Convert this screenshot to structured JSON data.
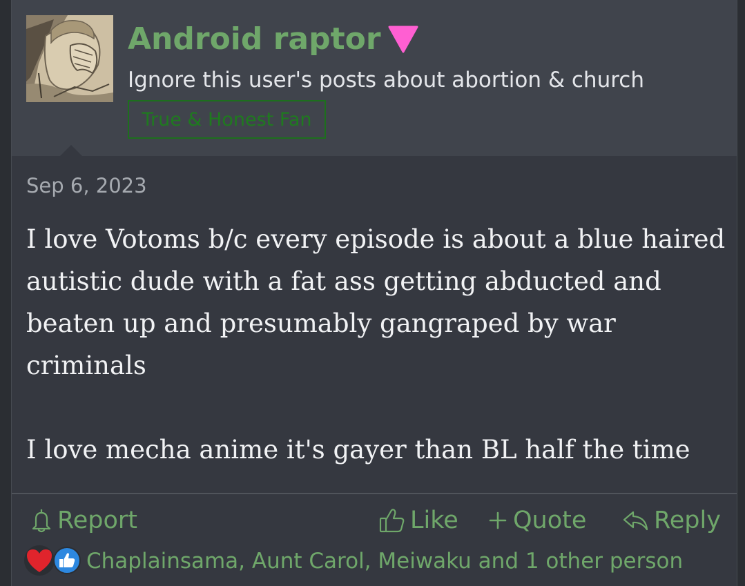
{
  "user": {
    "name": "Android raptor",
    "badge_icon": "pink-down-triangle-icon",
    "badge_color": "#ff5fd2",
    "title": "Ignore this user's posts about abortion & church",
    "banner": "True & Honest Fan"
  },
  "post": {
    "date": "Sep 6, 2023",
    "paragraphs": [
      "I love Votoms b/c every episode is about a blue haired autistic dude with a fat ass getting abducted and beaten up and presumably gangraped by war criminals",
      "I love mecha anime it's gayer than BL half the time"
    ]
  },
  "actions": {
    "report": "Report",
    "like": "Like",
    "quote": "Quote",
    "reply": "Reply"
  },
  "reactions": {
    "icons": [
      "heart-icon",
      "thumbs-up-icon"
    ],
    "names": "Chaplainsama, Aunt Carol, Meiwaku and 1 other person"
  },
  "colors": {
    "accent": "#6fa76a",
    "background": "#353840",
    "user_block": "#40444c",
    "banner": "#1f7a1f",
    "heart": "#e0242c",
    "like": "#2d88e0"
  }
}
